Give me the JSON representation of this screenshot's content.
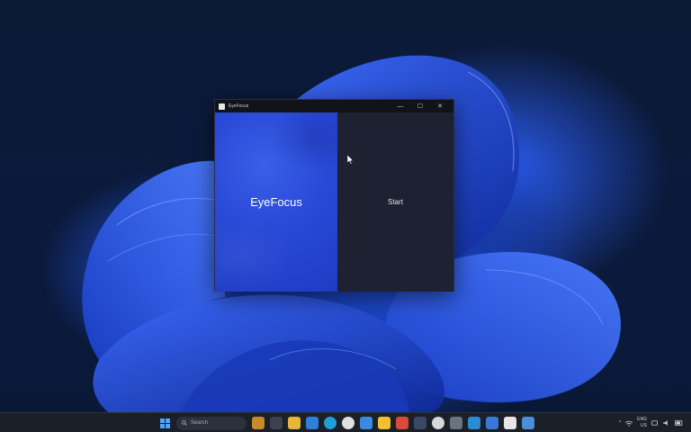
{
  "window": {
    "title": "EyeFocus",
    "minimize_glyph": "—",
    "maximize_glyph": "☐",
    "close_glyph": "✕"
  },
  "app": {
    "hero_title": "EyeFocus",
    "start_label": "Start"
  },
  "taskbar": {
    "left_text": "",
    "search_placeholder": "Search",
    "tray": {
      "chevron": "^",
      "lang_top": "ENG",
      "lang_bottom": "US",
      "clock_time": "",
      "clock_date": ""
    },
    "pinned_icons": [
      "widgets-icon",
      "task-view-icon",
      "file-explorer-icon",
      "store-icon",
      "edge-icon",
      "chrome-icon",
      "mail-icon",
      "photos-icon",
      "notes-icon",
      "terminal-icon",
      "github-icon",
      "settings-icon",
      "vscode-icon",
      "calculator-icon",
      "app-icon",
      "app2-icon"
    ]
  },
  "colors": {
    "accent": "#2848d6",
    "start_blue": "#4ca6ff",
    "panel_dark": "#1d2131"
  }
}
